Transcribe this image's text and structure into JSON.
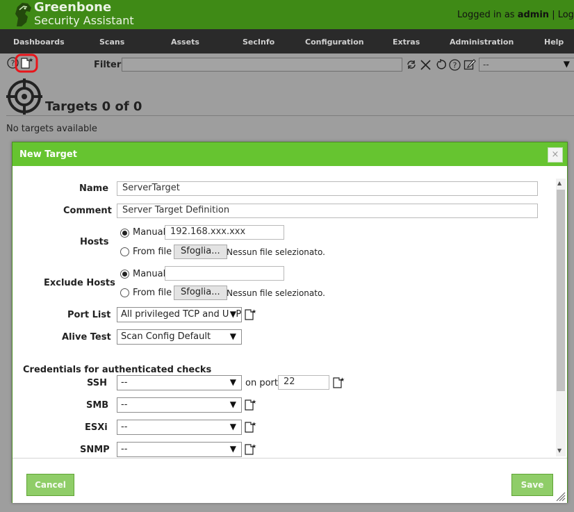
{
  "app": {
    "brand_line1": "Greenbone",
    "brand_line2": "Security Assistant",
    "login_prefix": "Logged in as",
    "user": "admin",
    "login_suffix": "| Logo"
  },
  "nav": {
    "items": [
      "Dashboards",
      "Scans",
      "Assets",
      "SecInfo",
      "Configuration",
      "Extras",
      "Administration",
      "Help"
    ]
  },
  "toolbar": {
    "filter_label": "Filter",
    "filter_value": "",
    "filter_select": "--"
  },
  "page": {
    "title": "Targets 0 of 0",
    "empty_message": "No targets available"
  },
  "dialog": {
    "title": "New Target",
    "close": "×",
    "name_label": "Name",
    "name_value": "ServerTarget",
    "comment_label": "Comment",
    "comment_value": "Server Target Definition",
    "hosts_label": "Hosts",
    "hosts_manual_label": "Manual",
    "hosts_manual_value": "192.168.xxx.xxx",
    "hosts_from_file_label": "From file",
    "hosts_file_button": "Sfoglia...",
    "hosts_file_status": "Nessun file selezionato.",
    "exclude_label": "Exclude Hosts",
    "exclude_manual_label": "Manual",
    "exclude_manual_value": "",
    "exclude_from_file_label": "From file",
    "exclude_file_button": "Sfoglia...",
    "exclude_file_status": "Nessun file selezionato.",
    "port_list_label": "Port List",
    "port_list_value": "All privileged TCP and UDP",
    "alive_test_label": "Alive Test",
    "alive_test_value": "Scan Config Default",
    "credentials_title": "Credentials for authenticated checks",
    "ssh_label": "SSH",
    "ssh_value": "--",
    "on_port_label": "on port",
    "ssh_port": "22",
    "smb_label": "SMB",
    "smb_value": "--",
    "esxi_label": "ESXi",
    "esxi_value": "--",
    "snmp_label": "SNMP",
    "snmp_value": "--",
    "cancel_label": "Cancel",
    "save_label": "Save"
  },
  "colors": {
    "header_green": "#66c430",
    "nav_dark": "#2a2a2a",
    "button_green": "#8fcd68",
    "highlight_red": "#e8141a"
  },
  "icons": [
    "greenbone-logo-icon",
    "help-icon",
    "new-target-icon",
    "refresh-icon",
    "reset-filter-icon",
    "revert-icon",
    "filter-help-icon",
    "edit-filter-icon",
    "target-icon",
    "new-credential-icon",
    "resize-grip-icon"
  ]
}
